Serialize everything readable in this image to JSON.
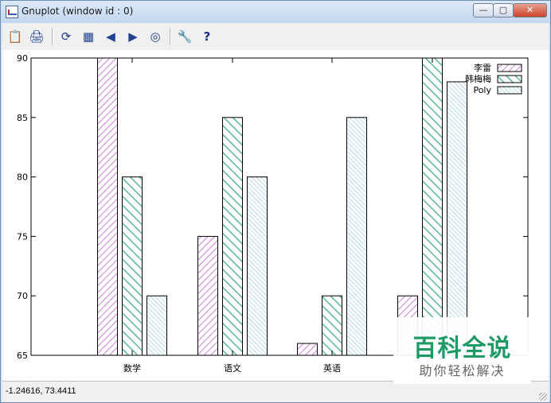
{
  "window": {
    "title": "Gnuplot (window id : 0)",
    "close_glyph": "✕",
    "min_glyph": "—",
    "max_glyph": "▢"
  },
  "toolbar": {
    "items": [
      {
        "icon": "clipboard-icon",
        "glyph": "📋"
      },
      {
        "icon": "print-icon",
        "glyph": "🖨"
      },
      {
        "icon": "replot-icon",
        "glyph": "⟳"
      },
      {
        "icon": "grid-icon",
        "glyph": "▦"
      },
      {
        "icon": "zoom-previous-icon",
        "glyph": "◀"
      },
      {
        "icon": "zoom-next-icon",
        "glyph": "▶"
      },
      {
        "icon": "autoscale-icon",
        "glyph": "◎"
      },
      {
        "icon": "options-icon",
        "glyph": "🔧"
      },
      {
        "icon": "help-icon",
        "glyph": "?"
      }
    ]
  },
  "status": {
    "coords": "-1.24616,  73.4411"
  },
  "watermark": {
    "main": "百科全说",
    "sub": "助你轻松解决"
  },
  "chart_data": {
    "type": "bar",
    "categories": [
      "数学",
      "语文",
      "英语",
      ""
    ],
    "series": [
      {
        "name": "李雷",
        "values": [
          90,
          75,
          66,
          70
        ],
        "color": "#c060d0"
      },
      {
        "name": "韩梅梅",
        "values": [
          80,
          85,
          70,
          90
        ],
        "color": "#40b080"
      },
      {
        "name": "Poly",
        "values": [
          70,
          80,
          85,
          88
        ],
        "color": "#70b8d8"
      }
    ],
    "yticks": [
      "65",
      "70",
      "75",
      "80",
      "85",
      "90"
    ],
    "ylim": [
      65,
      90
    ],
    "legend": "top-right",
    "grid": false,
    "title": "",
    "xlabel": "",
    "ylabel": ""
  }
}
